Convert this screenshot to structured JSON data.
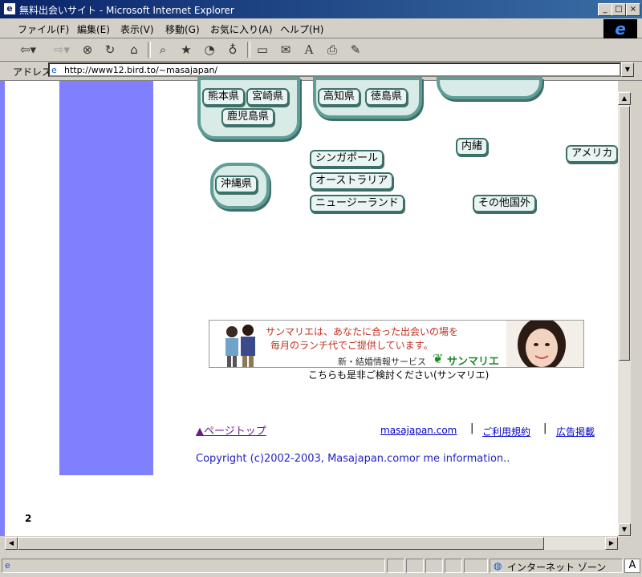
{
  "window": {
    "title": "無料出会いサイト - Microsoft Internet Explorer",
    "controls": {
      "minimize": "_",
      "maximize": "□",
      "close": "×"
    }
  },
  "menu": [
    "ファイル(F)",
    "編集(E)",
    "表示(V)",
    "移動(G)",
    "お気に入り(A)",
    "ヘルプ(H)"
  ],
  "toolbar": {
    "icons": [
      "back-icon",
      "forward-icon",
      "stop-icon",
      "refresh-icon",
      "home-icon",
      "search-icon",
      "favorites-icon",
      "history-icon",
      "channels-icon",
      "fullscreen-icon",
      "mail-icon",
      "font-icon",
      "print-icon",
      "edit-icon"
    ]
  },
  "address": {
    "label": "アドレス",
    "url": "http://www12.bird.to/~masajapan/"
  },
  "regions": {
    "kyushu": [
      "熊本県",
      "宮崎県",
      "鹿児島県"
    ],
    "shikoku": [
      "高知県",
      "徳島県"
    ],
    "okinawa": "沖縄県",
    "oceania_asia": [
      "シンガポール",
      "オーストラリア",
      "ニュージーランド"
    ],
    "other": [
      "内緒",
      "アメリカ",
      "その他国外"
    ]
  },
  "banner": {
    "line1": "サンマリエは、あなたに合った出会いの場を",
    "line2": "毎月のランチ代でご提供しています。",
    "service": "新・結婚情報サービス",
    "brand": "サンマリエ",
    "caption": "こちらも是非ご検討ください(サンマリエ)"
  },
  "footer": {
    "pagetop": "▲ページトップ",
    "links": [
      "masajapan.com",
      "ご利用規約",
      "広告掲載"
    ],
    "separator": "|",
    "copyright": "Copyright (c)2002-2003, Masajapan.comor me information..",
    "page_number": "2"
  },
  "status": {
    "zone": "インターネット ゾーン"
  },
  "colors": {
    "sidebar": "#8080ff",
    "pill_border": "#3d6f69",
    "titlebar": "#0a246a"
  }
}
